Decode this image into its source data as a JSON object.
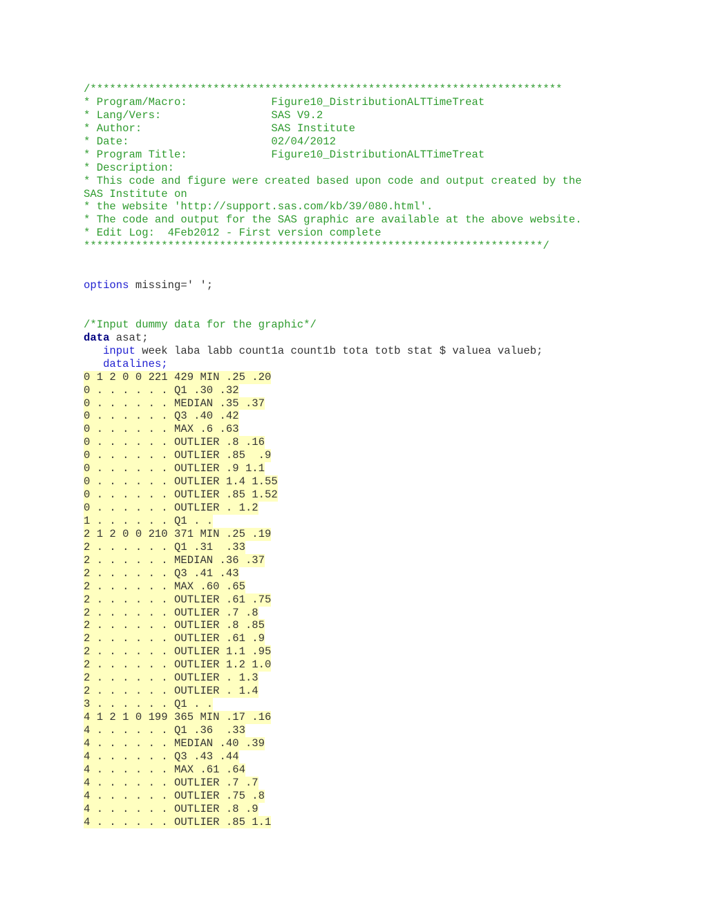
{
  "header_comment": {
    "open": "/*************************************************************************",
    "fields": [
      {
        "label": "* Program/Macro:",
        "value": "Figure10_DistributionALTTimeTreat"
      },
      {
        "label": "* Lang/Vers:",
        "value": "SAS V9.2"
      },
      {
        "label": "* Author:",
        "value": "SAS Institute"
      },
      {
        "label": "* Date:",
        "value": "02/04/2012"
      },
      {
        "label": "* Program Title:",
        "value": "Figure10_DistributionALTTimeTreat"
      }
    ],
    "description_label": "* Description:",
    "description_lines": [
      "* This code and figure were created based upon code and output created by the",
      "SAS Institute on",
      "* the website 'http://support.sas.com/kb/39/080.html'.",
      "* The code and output for the SAS graphic are available at the above website.",
      "* Edit Log:  4Feb2012 - First version complete"
    ],
    "close": "***********************************************************************/"
  },
  "options_stmt": {
    "keyword": "options",
    "rest": " missing=' ';"
  },
  "data_comment": "/*Input dummy data for the graphic*/",
  "data_stmt": {
    "keyword": "data",
    "rest": " asat;"
  },
  "input_stmt": {
    "keyword": "input",
    "rest": " week laba labb count1a count1b tota totb stat $ valuea valueb;"
  },
  "datalines_stmt": "datalines;",
  "datalines": [
    "0 1 2 0 0 221 429 MIN .25 .20",
    "0 . . . . . . Q1 .30 .32",
    "0 . . . . . . MEDIAN .35 .37",
    "0 . . . . . . Q3 .40 .42",
    "0 . . . . . . MAX .6 .63",
    "0 . . . . . . OUTLIER .8 .16",
    "0 . . . . . . OUTLIER .85  .9",
    "0 . . . . . . OUTLIER .9 1.1",
    "0 . . . . . . OUTLIER 1.4 1.55",
    "0 . . . . . . OUTLIER .85 1.52",
    "0 . . . . . . OUTLIER . 1.2",
    "1 . . . . . . Q1 . .",
    "2 1 2 0 0 210 371 MIN .25 .19",
    "2 . . . . . . Q1 .31  .33",
    "2 . . . . . . MEDIAN .36 .37",
    "2 . . . . . . Q3 .41 .43",
    "2 . . . . . . MAX .60 .65",
    "2 . . . . . . OUTLIER .61 .75",
    "2 . . . . . . OUTLIER .7 .8",
    "2 . . . . . . OUTLIER .8 .85",
    "2 . . . . . . OUTLIER .61 .9",
    "2 . . . . . . OUTLIER 1.1 .95",
    "2 . . . . . . OUTLIER 1.2 1.0",
    "2 . . . . . . OUTLIER . 1.3",
    "2 . . . . . . OUTLIER . 1.4",
    "3 . . . . . . Q1 . .",
    "4 1 2 1 0 199 365 MIN .17 .16",
    "4 . . . . . . Q1 .36  .33",
    "4 . . . . . . MEDIAN .40 .39",
    "4 . . . . . . Q3 .43 .44",
    "4 . . . . . . MAX .61 .64",
    "4 . . . . . . OUTLIER .7 .7",
    "4 . . . . . . OUTLIER .75 .8",
    "4 . . . . . . OUTLIER .8 .9",
    "4 . . . . . . OUTLIER .85 1.1"
  ],
  "colors": {
    "comment": "#2e9b2e",
    "keyword": "#1f1fd0",
    "bold_keyword": "#000080",
    "text": "#333333",
    "datalines_highlight": "#ffffc0"
  }
}
